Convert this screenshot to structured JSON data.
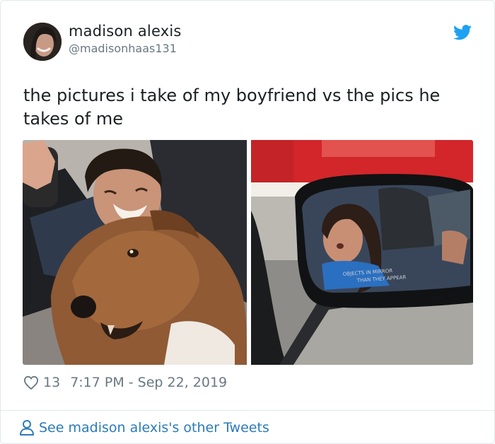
{
  "tweet": {
    "user_name": "madison alexis",
    "handle": "@madisonhaas131",
    "text": "the pictures i take of my boyfriend vs the pics he takes of me",
    "like_count": "13",
    "timestamp": "7:17 PM - Sep 22, 2019"
  },
  "footer": {
    "link_label": "See madison alexis's other Tweets"
  },
  "icons": {
    "brand": "twitter-bird-icon",
    "like": "heart-outline-icon",
    "profile": "person-outline-icon"
  },
  "colors": {
    "twitter_blue": "#1da1f2",
    "link_blue": "#2b7bb9",
    "meta_gray": "#697882",
    "text": "#1c2022"
  },
  "media": [
    {
      "name": "boyfriend-with-dog-photo"
    },
    {
      "name": "girlfriend-sleeping-in-car-mirror-photo",
      "mirror_caption": "OBJECTS IN MIRROR ARE CLOSER THAN THEY APPEAR"
    }
  ]
}
